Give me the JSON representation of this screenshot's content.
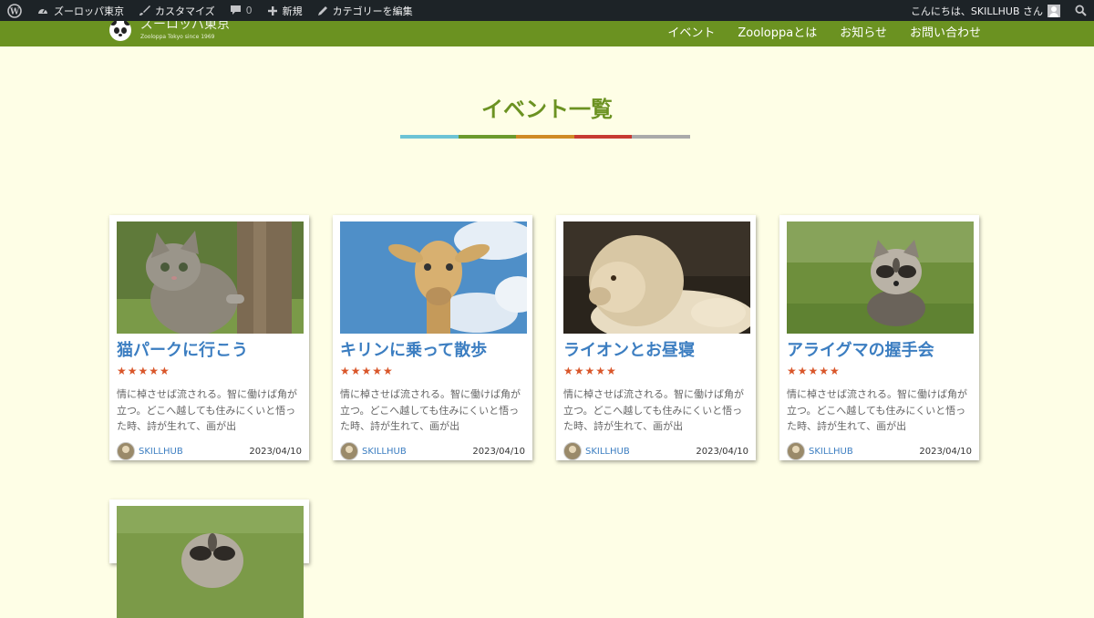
{
  "adminbar": {
    "site_name": "ズーロッパ東京",
    "customize": "カスタマイズ",
    "comments_count": "0",
    "new_label": "新規",
    "edit_category": "カテゴリーを編集",
    "greeting": "こんにちは、SKILLHUB さん"
  },
  "site": {
    "title": "ズーロッパ東京",
    "tagline": "Zooloppa Tokyo since 1969"
  },
  "nav": [
    "イベント",
    "Zooloppaとは",
    "お知らせ",
    "お問い合わせ"
  ],
  "page_title": "イベント一覧",
  "title_rule_colors": [
    "#6cc3d5",
    "#6b9a2e",
    "#d08b26",
    "#c73a33",
    "#aaaaaa"
  ],
  "cards": [
    {
      "title": "猫パークに行こう",
      "photo": "cat-photo",
      "stars": "★★★★★",
      "excerpt": "情に棹させば流される。智に働けば角が立つ。どこへ越しても住みにくいと悟った時、詩が生れて、画が出",
      "author": "SKILLHUB",
      "date": "2023/04/10"
    },
    {
      "title": "キリンに乗って散歩",
      "photo": "giraffe-photo",
      "stars": "★★★★★",
      "excerpt": "情に棹させば流される。智に働けば角が立つ。どこへ越しても住みにくいと悟った時、詩が生れて、画が出",
      "author": "SKILLHUB",
      "date": "2023/04/10"
    },
    {
      "title": "ライオンとお昼寝",
      "photo": "lion-photo",
      "stars": "★★★★★",
      "excerpt": "情に棹させば流される。智に働けば角が立つ。どこへ越しても住みにくいと悟った時、詩が生れて、画が出",
      "author": "SKILLHUB",
      "date": "2023/04/10"
    },
    {
      "title": "アライグマの握手会",
      "photo": "raccoon-photo",
      "stars": "★★★★★",
      "excerpt": "情に棹させば流される。智に働けば角が立つ。どこへ越しても住みにくいと悟った時、詩が生れて、画が出",
      "author": "SKILLHUB",
      "date": "2023/04/10"
    },
    {
      "photo": "raccoon-photo"
    }
  ]
}
